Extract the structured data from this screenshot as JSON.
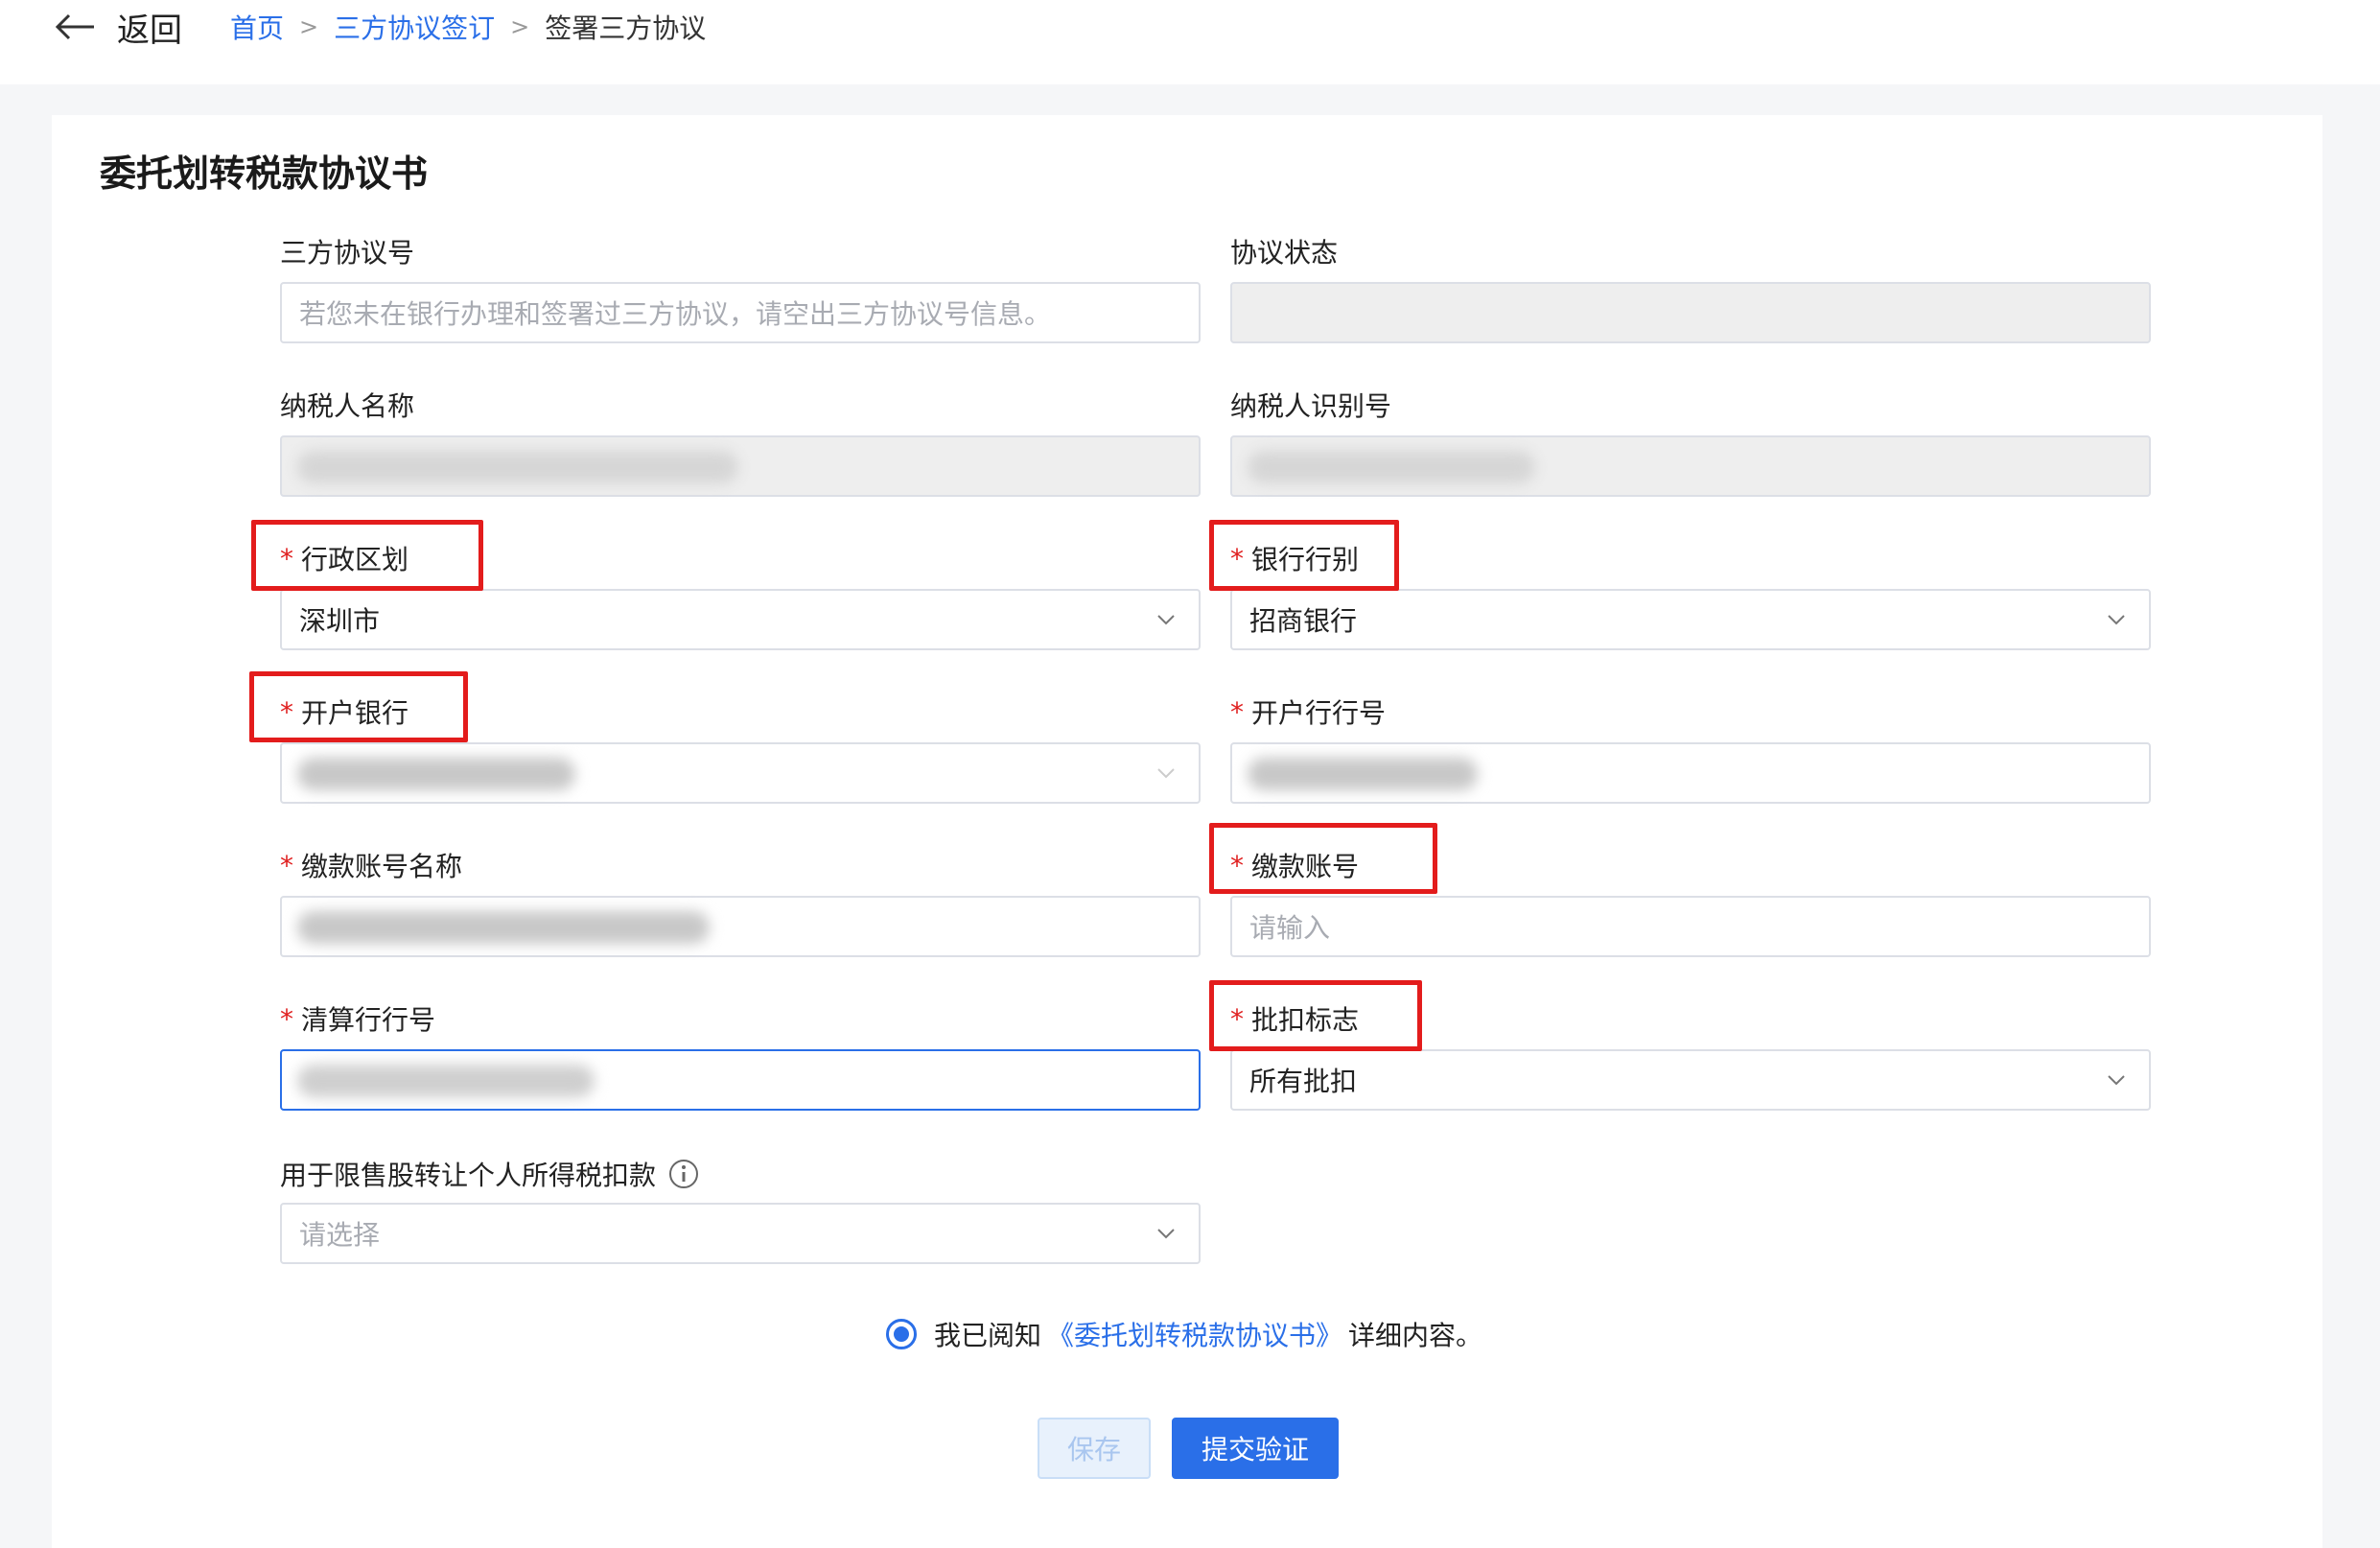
{
  "header": {
    "back_label": "返回",
    "breadcrumb": {
      "home": "首页",
      "parent": "三方协议签订",
      "current": "签署三方协议",
      "separator": ">"
    }
  },
  "form": {
    "title": "委托划转税款协议书",
    "agreement_no": {
      "label": "三方协议号",
      "placeholder": "若您未在银行办理和签署过三方协议，请空出三方协议号信息。"
    },
    "agreement_status": {
      "label": "协议状态",
      "value": ""
    },
    "taxpayer_name": {
      "label": "纳税人名称",
      "value": ""
    },
    "taxpayer_id": {
      "label": "纳税人识别号",
      "value": ""
    },
    "region": {
      "label": "行政区划",
      "required_mark": "*",
      "value": "深圳市"
    },
    "bank_type": {
      "label": "银行行别",
      "required_mark": "*",
      "value": "招商银行"
    },
    "open_bank": {
      "label": "开户银行",
      "required_mark": "*",
      "value": ""
    },
    "open_bank_no": {
      "label": "开户行行号",
      "required_mark": "*",
      "value": ""
    },
    "account_name": {
      "label": "缴款账号名称",
      "required_mark": "*",
      "value": ""
    },
    "account_no": {
      "label": "缴款账号",
      "required_mark": "*",
      "placeholder": "请输入"
    },
    "clearing_bank_no": {
      "label": "清算行行号",
      "required_mark": "*",
      "value": ""
    },
    "batch_flag": {
      "label": "批扣标志",
      "required_mark": "*",
      "value": "所有批扣"
    },
    "restricted_stock": {
      "label": "用于限售股转让个人所得税扣款",
      "placeholder": "请选择"
    }
  },
  "agreement": {
    "prefix": "我已阅知",
    "link": "《委托划转税款协议书》",
    "suffix": "详细内容。",
    "checked": true
  },
  "buttons": {
    "save": "保存",
    "submit": "提交验证"
  },
  "colors": {
    "accent": "#2a6fe8",
    "highlight": "#e31c1c",
    "required": "#e02020"
  },
  "icons": {
    "back": "arrow-left-icon",
    "chevron": "chevron-down-icon",
    "info": "info-circle-icon"
  }
}
